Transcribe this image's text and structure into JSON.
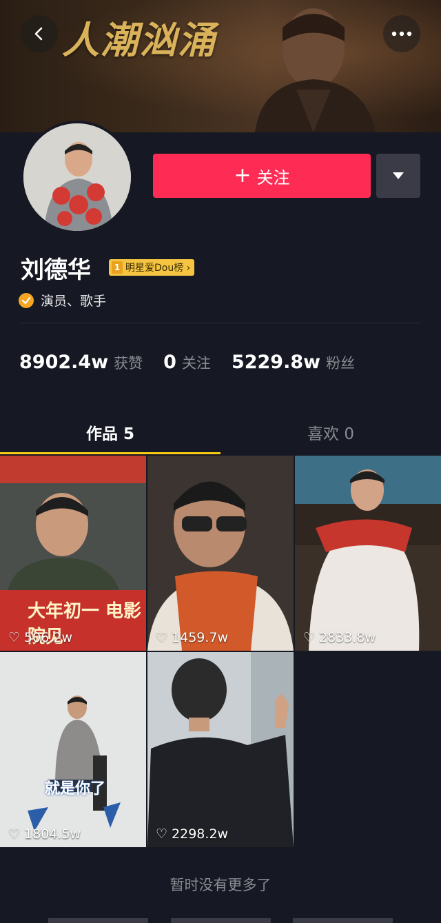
{
  "banner": {
    "title": "人潮汹涌"
  },
  "profile": {
    "name": "刘德华",
    "rank_number": "1",
    "rank_label": "明星爱Dou榜 ›",
    "verify_text": "演员、歌手"
  },
  "actions": {
    "follow_label": "关注"
  },
  "stats": [
    {
      "value": "8902.4w",
      "label": "获赞"
    },
    {
      "value": "0",
      "label": "关注"
    },
    {
      "value": "5229.8w",
      "label": "粉丝"
    }
  ],
  "tabs": [
    {
      "label": "作品 5"
    },
    {
      "label": "喜欢 0"
    }
  ],
  "videos": [
    {
      "likes": "506.2w",
      "overlay": "大年初一 电影院见"
    },
    {
      "likes": "1459.7w"
    },
    {
      "likes": "2833.8w"
    },
    {
      "likes": "1804.5w",
      "overlay": "就是你了"
    },
    {
      "likes": "2298.2w"
    }
  ],
  "footer": {
    "no_more": "暂时没有更多了"
  },
  "colors": {
    "accent": "#fe2c55",
    "tab_indicator": "#facd14",
    "background": "#161823",
    "verify": "#f6a623"
  }
}
